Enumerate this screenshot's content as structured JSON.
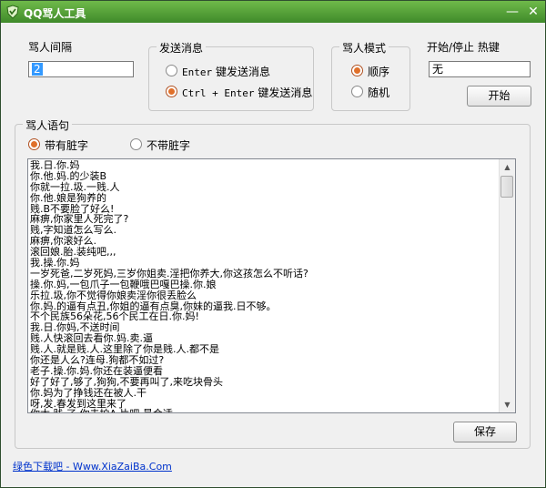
{
  "window": {
    "title": "QQ骂人工具",
    "minimize_glyph": "—",
    "close_glyph": "✕"
  },
  "interval": {
    "label": "骂人间隔",
    "value": "2"
  },
  "send": {
    "group_title": "发送消息",
    "option1_key": "Enter",
    "option1_label": "键发送消息",
    "option2_key": "Ctrl + Enter",
    "option2_label": "键发送消息",
    "selected": 2
  },
  "mode": {
    "group_title": "骂人模式",
    "option1_label": "顺序",
    "option2_label": "随机",
    "selected": 1
  },
  "hotkey": {
    "label": "开始/停止 热键",
    "value": "无",
    "start_button": "开始"
  },
  "phrases": {
    "group_title": "骂人语句",
    "option1_label": "带有脏字",
    "option2_label": "不带脏字",
    "selected": 1,
    "lines": [
      "我.日.你.妈",
      "你.他.妈.的少装B",
      "你就一拉.圾.一贱.人",
      "你.他.娘是狗养的",
      "贱.B不要脸了好么!",
      "麻痹,你家里人死完了?",
      "贱,字知道怎么写么.",
      "麻痹,你滚好么.",
      "滚回娘.胎.装纯吧,,,",
      "我.操.你.妈",
      "一岁死爸,二岁死妈,三岁你姐卖.淫把你养大,你这孩怎么不听话?",
      "操.你.妈,一包爪子一包鞭哦巴嘎巴操.你.娘",
      "乐拉.圾,你不觉得你娘卖淫你很丢脸么",
      "你.妈.的逼有点丑,你姐的逼有点臭,你妹的逼我.日不够。",
      "不个民族56朵花,56个民工在日.你.妈!",
      "我.日.你妈,不送时间",
      "贱.人快滚回去看你.妈.卖.逼",
      "贱.人.就是贱.人.这里除了你是贱.人.都不是",
      "你还是人么?连母.狗都不如过?",
      "老子.操.你.妈.你还在装逼便看",
      "好了好了,够了,狗狗,不要再叫了,来吃块骨头",
      "你.妈为了挣钱还在被人.干",
      "呀,发.春发到这里来了",
      "你太.贱.了,你去拍A.片吧,最合适"
    ],
    "save_button": "保存"
  },
  "footer": {
    "link_text": "绿色下载吧 - Www.XiaZaiBa.Com"
  }
}
